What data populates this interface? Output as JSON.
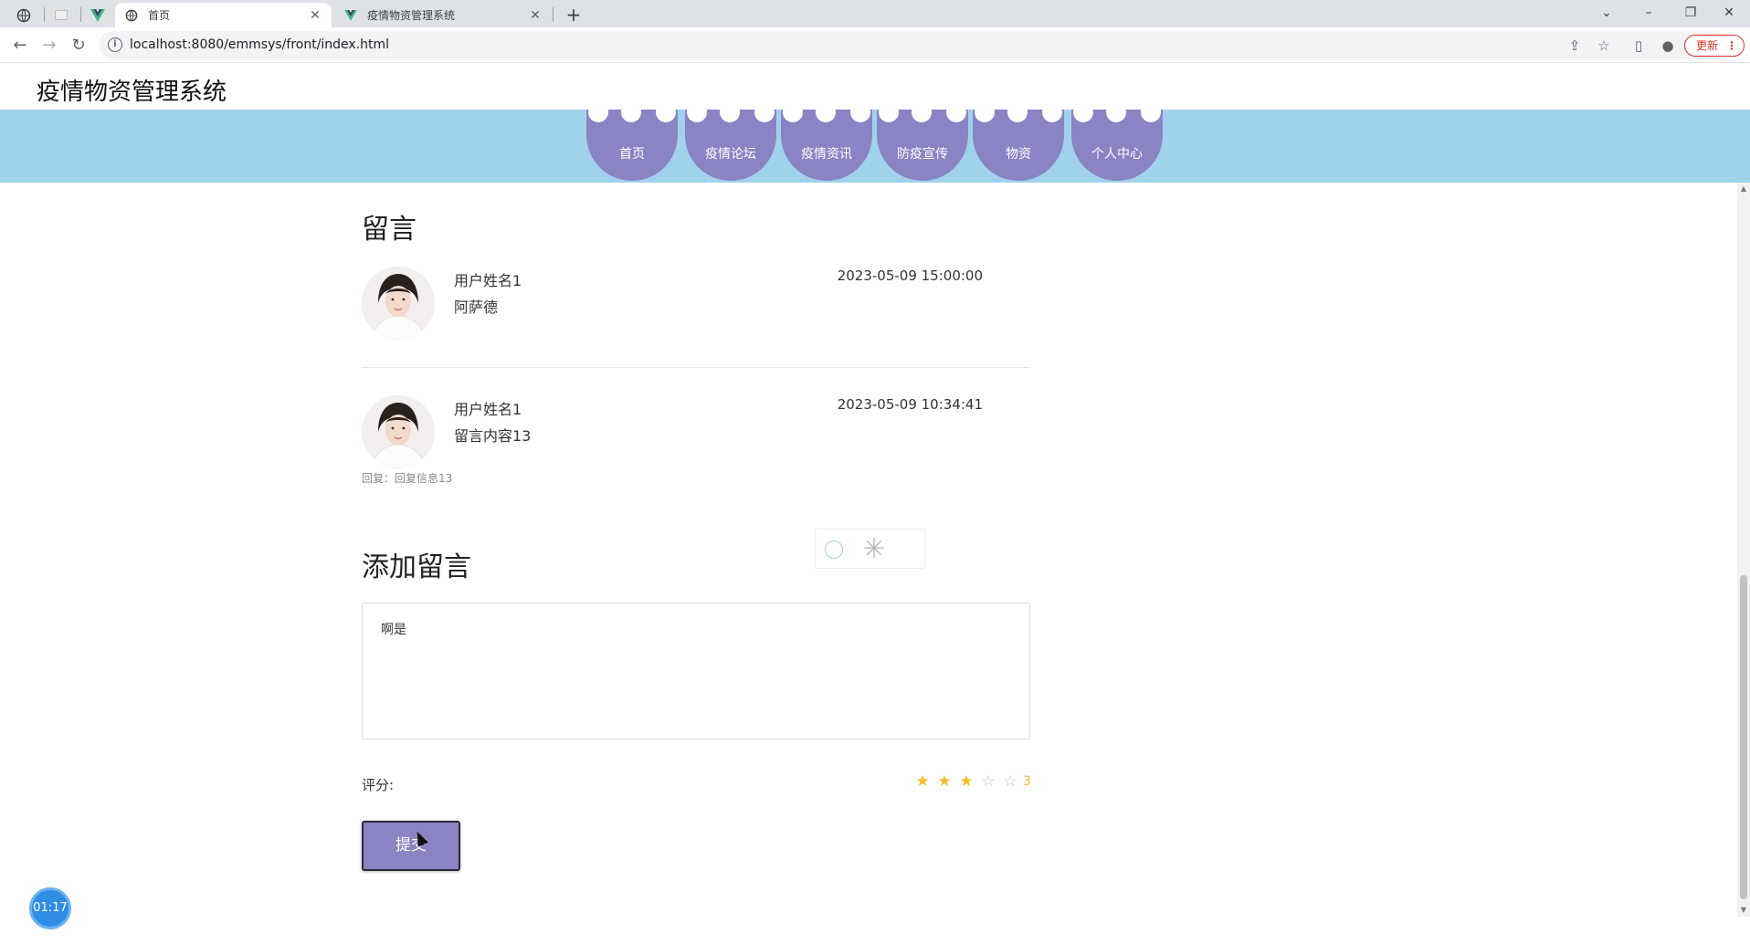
{
  "browser": {
    "tabs": [
      {
        "title": "首页",
        "active": true
      },
      {
        "title": "疫情物资管理系统",
        "active": false
      }
    ],
    "url": "localhost:8080/emmsys/front/index.html",
    "update_label": "更新"
  },
  "header": {
    "site_title": "疫情物资管理系统"
  },
  "nav": {
    "items": [
      {
        "label": "首页"
      },
      {
        "label": "疫情论坛"
      },
      {
        "label": "疫情资讯"
      },
      {
        "label": "防疫宣传"
      },
      {
        "label": "物资"
      },
      {
        "label": "个人中心"
      }
    ]
  },
  "messages": {
    "title": "留言",
    "items": [
      {
        "user": "用户姓名1",
        "content": "阿萨德",
        "time": "2023-05-09 15:00:00"
      },
      {
        "user": "用户姓名1",
        "content": "留言内容13",
        "time": "2023-05-09 10:34:41",
        "reply": "回复：回复信息13"
      }
    ]
  },
  "add_message": {
    "title": "添加留言",
    "content_value": "啊是",
    "rating_label": "评分:",
    "rating": 3,
    "rating_max": 5,
    "rating_text": "3",
    "submit_label": "提交"
  },
  "timer": {
    "text": "01:17"
  },
  "colors": {
    "nav_bg": "#a0d2ec",
    "nav_item": "#8a83c4",
    "star": "#f7ba2a",
    "button": "#8a83c4"
  }
}
